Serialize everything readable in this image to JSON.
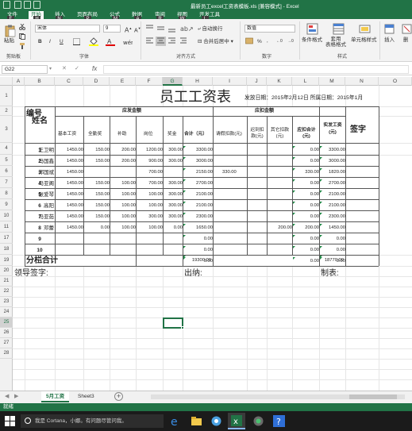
{
  "window": {
    "title": "最新员工excel工资表模板.xls  [兼容模式] - Excel"
  },
  "ribbon_tabs": [
    "文件",
    "开始",
    "插入",
    "页面布局",
    "公式",
    "数据",
    "审阅",
    "视图",
    "开发工具"
  ],
  "keytips": [
    "F",
    "H",
    "N",
    "P",
    "M",
    "A",
    "R",
    "W",
    "L"
  ],
  "ribbon": {
    "paste": "粘贴",
    "clipboard": "剪贴板",
    "font_name": "宋体",
    "font_size": "9",
    "font_group": "字体",
    "bold": "B",
    "italic": "I",
    "underline": "U",
    "wrap_text": "自动换行",
    "merge_center": "合并后居中",
    "align_group": "对齐方式",
    "number_format": "数值",
    "percent": "%",
    "number_group": "数字",
    "conditional_format": "条件格式",
    "format_as_table": "套用\n表格格式",
    "cell_styles": "单元格样式",
    "styles_group": "样式",
    "insert": "插入",
    "delete": "删"
  },
  "formula_bar": {
    "name_box": "G22",
    "fx": "fx",
    "value": ""
  },
  "columns": [
    "A",
    "B",
    "C",
    "D",
    "E",
    "F",
    "G",
    "H",
    "I",
    "J",
    "K",
    "L",
    "M",
    "N",
    "O"
  ],
  "rows": [
    "1",
    "2",
    "3",
    "4",
    "5",
    "6",
    "7",
    "8",
    "9",
    "10",
    "11",
    "17",
    "18",
    "19",
    "20",
    "21",
    "22",
    "23",
    "24",
    "25",
    "26",
    "27",
    "28"
  ],
  "selected": {
    "column": "G",
    "row": "22"
  },
  "sheet": {
    "title": "员工工资表",
    "issue_date": "发放日期：2015年2月12日 所属日期：2015年1月",
    "header_no": "编号",
    "header_name": "姓名",
    "header_payable": "应发金额",
    "header_deduct": "应扣金额",
    "header_signature": "签字",
    "sub_headers": {
      "base": "基本工资",
      "attendance": "全勤奖",
      "subsidy": "补助",
      "position": "岗位",
      "bonus": "奖金",
      "payable_total": "合计（元）",
      "sick": "请假扣款(元)",
      "late": "迟到扣款(元)",
      "other": "其它扣款(元)",
      "deduct_total": "应扣合计(元)",
      "net": "实发工资(元)"
    },
    "employees": [
      {
        "no": "1",
        "name": "王卫明",
        "base": "1450.00",
        "attendance": "150.00",
        "subsidy": "200.00",
        "position": "1200.00",
        "bonus": "300.00",
        "total": "3300.00",
        "sick": "",
        "late": "",
        "other": "",
        "deduct": "0.00",
        "net": "3300.00"
      },
      {
        "no": "2",
        "name": "马国鑫",
        "base": "1450.00",
        "attendance": "150.00",
        "subsidy": "200.00",
        "position": "900.00",
        "bonus": "300.00",
        "total": "3000.00",
        "sick": "",
        "late": "",
        "other": "",
        "deduct": "0.00",
        "net": "3000.00"
      },
      {
        "no": "3",
        "name": "郑国斌",
        "base": "1450.00",
        "attendance": "",
        "subsidy": "",
        "position": "700.00",
        "bonus": "",
        "total": "2150.00",
        "sick": "330.00",
        "late": "",
        "other": "",
        "deduct": "330.00",
        "net": "1820.00"
      },
      {
        "no": "4",
        "name": "马亚阁",
        "base": "1450.00",
        "attendance": "150.00",
        "subsidy": "100.00",
        "position": "700.00",
        "bonus": "300.00",
        "total": "2700.00",
        "sick": "",
        "late": "",
        "other": "",
        "deduct": "0.00",
        "net": "2700.00"
      },
      {
        "no": "5",
        "name": "张爱琴",
        "base": "1450.00",
        "attendance": "150.00",
        "subsidy": "100.00",
        "position": "100.00",
        "bonus": "300.00",
        "total": "2100.00",
        "sick": "",
        "late": "",
        "other": "",
        "deduct": "0.00",
        "net": "2100.00"
      },
      {
        "no": "6",
        "name": "高阳",
        "base": "1450.00",
        "attendance": "150.00",
        "subsidy": "100.00",
        "position": "100.00",
        "bonus": "300.00",
        "total": "2100.00",
        "sick": "",
        "late": "",
        "other": "",
        "deduct": "0.00",
        "net": "2100.00"
      },
      {
        "no": "7",
        "name": "马亚茹",
        "base": "1450.00",
        "attendance": "150.00",
        "subsidy": "100.00",
        "position": "300.00",
        "bonus": "300.00",
        "total": "2300.00",
        "sick": "",
        "late": "",
        "other": "",
        "deduct": "0.00",
        "net": "2300.00"
      },
      {
        "no": "8",
        "name": "邓蕾",
        "base": "1450.00",
        "attendance": "0.00",
        "subsidy": "100.00",
        "position": "100.00",
        "bonus": "0.00",
        "total": "1650.00",
        "sick": "",
        "late": "",
        "other": "200.00",
        "deduct": "200.00",
        "net": "1450.00"
      },
      {
        "no": "9",
        "name": "",
        "base": "",
        "attendance": "",
        "subsidy": "",
        "position": "",
        "bonus": "",
        "total": "0.00",
        "sick": "",
        "late": "",
        "other": "",
        "deduct": "0.00",
        "net": "0.00"
      },
      {
        "no": "10",
        "name": "",
        "base": "",
        "attendance": "",
        "subsidy": "",
        "position": "",
        "bonus": "",
        "total": "0.00",
        "sick": "",
        "late": "",
        "other": "",
        "deduct": "0.00",
        "net": "0.00"
      },
      {
        "no": "11",
        "name": "",
        "base": "",
        "attendance": "",
        "subsidy": "",
        "position": "",
        "bonus": "",
        "total": "0.00",
        "sick": "",
        "late": "",
        "other": "",
        "deduct": "0.00",
        "net": "0.00"
      }
    ],
    "total_label": "分栏合计",
    "total_payable": "19300.00",
    "total_net": "18770.00",
    "sign_leader": "领导签字:",
    "sign_cashier": "出纳:",
    "sign_maker": "制表:"
  },
  "sheet_tabs": [
    "5月工资",
    "Sheet3"
  ],
  "add_sheet": "+",
  "status": "就绪",
  "taskbar": {
    "search_placeholder": "我是 Cortana，小娜。有问题尽管问我。"
  },
  "colors": {
    "excel_green": "#217346",
    "taskbar": "#1b1b1b"
  }
}
